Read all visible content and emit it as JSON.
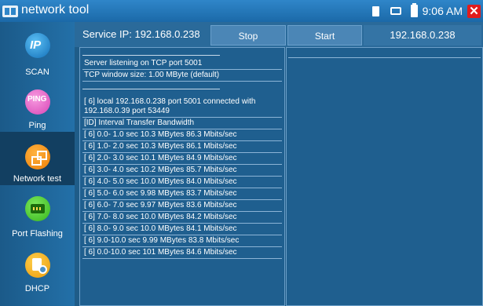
{
  "window": {
    "title": "network tool",
    "clock": "9:06 AM",
    "close_label": "✕"
  },
  "sidebar": {
    "items": [
      {
        "label": "SCAN",
        "icon": "ip-scan-icon",
        "glyph": "IP"
      },
      {
        "label": "Ping",
        "icon": "ping-icon",
        "glyph": "PING"
      },
      {
        "label": "Network test",
        "icon": "network-test-icon",
        "active": true
      },
      {
        "label": "Port Flashing",
        "icon": "port-flashing-icon"
      },
      {
        "label": "DHCP",
        "icon": "dhcp-icon"
      }
    ]
  },
  "toolbar": {
    "service_ip": "Service IP: 192.168.0.238",
    "stop_label": "Stop",
    "start_label": "Start",
    "client_ip": "192.168.0.238"
  },
  "log": {
    "listening": "Server listening on TCP port 5001",
    "window_size": "TCP window size: 1.00 MByte (default)",
    "connected": "[  6] local 192.168.0.238 port 5001 connected with 192.168.0.39 port 53449",
    "header": "[ID] Interval       Transfer     Bandwidth",
    "rows": [
      "[  6]  0.0- 1.0 sec  10.3 MBytes  86.3 Mbits/sec",
      "[  6]  1.0- 2.0 sec  10.3 MBytes  86.1 Mbits/sec",
      "[  6]  2.0- 3.0 sec  10.1 MBytes  84.9 Mbits/sec",
      "[  6]  3.0- 4.0 sec  10.2 MBytes  85.7 Mbits/sec",
      "[  6]  4.0- 5.0 sec  10.0 MBytes  84.0 Mbits/sec",
      "[  6]  5.0- 6.0 sec  9.98 MBytes  83.7 Mbits/sec",
      "[  6]  6.0- 7.0 sec  9.97 MBytes  83.6 Mbits/sec",
      "[  6]  7.0- 8.0 sec  10.0 MBytes  84.2 Mbits/sec",
      "[  6]  8.0- 9.0 sec  10.0 MBytes  84.1 Mbits/sec",
      "[  6]  9.0-10.0 sec  9.99 MBytes  83.8 Mbits/sec",
      "[  6]  0.0-10.0 sec   101 MBytes  84.6 Mbits/sec"
    ]
  }
}
